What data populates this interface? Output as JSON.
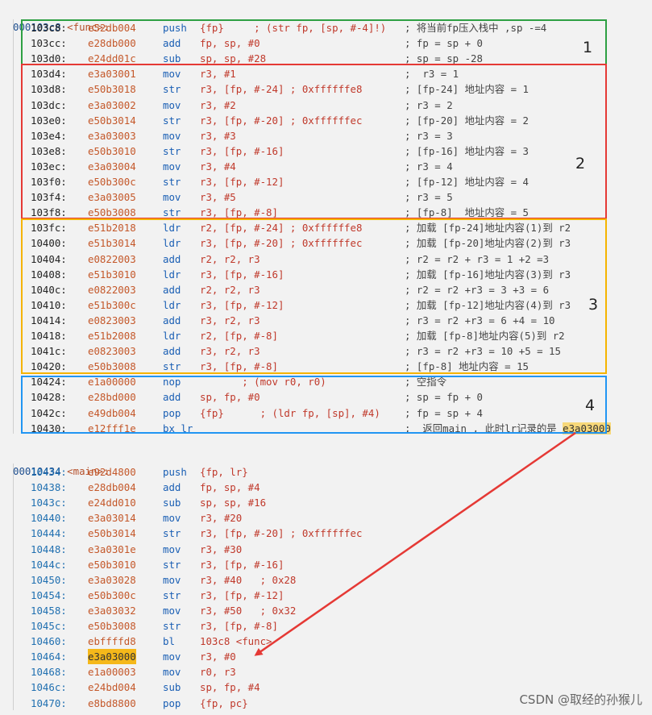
{
  "func": {
    "symbol_addr": "000103c8",
    "symbol_name": "<func>:",
    "lines": [
      {
        "addr": "103c8:",
        "code": "e52db004",
        "mn": "push",
        "ops": "{fp}     ; (str fp, [sp, #-4]!)",
        "cm": "; 将当前fp压入栈中 ,sp -=4"
      },
      {
        "addr": "103cc:",
        "code": "e28db000",
        "mn": "add",
        "ops": "fp, sp, #0",
        "cm": "; fp = sp + 0"
      },
      {
        "addr": "103d0:",
        "code": "e24dd01c",
        "mn": "sub",
        "ops": "sp, sp, #28",
        "cm": "; sp = sp -28"
      },
      {
        "addr": "103d4:",
        "code": "e3a03001",
        "mn": "mov",
        "ops": "r3, #1",
        "cm": ";  r3 = 1"
      },
      {
        "addr": "103d8:",
        "code": "e50b3018",
        "mn": "str",
        "ops": "r3, [fp, #-24] ; 0xffffffe8",
        "cm": "; [fp-24] 地址内容 = 1"
      },
      {
        "addr": "103dc:",
        "code": "e3a03002",
        "mn": "mov",
        "ops": "r3, #2",
        "cm": "; r3 = 2"
      },
      {
        "addr": "103e0:",
        "code": "e50b3014",
        "mn": "str",
        "ops": "r3, [fp, #-20] ; 0xffffffec",
        "cm": "; [fp-20] 地址内容 = 2"
      },
      {
        "addr": "103e4:",
        "code": "e3a03003",
        "mn": "mov",
        "ops": "r3, #3",
        "cm": "; r3 = 3"
      },
      {
        "addr": "103e8:",
        "code": "e50b3010",
        "mn": "str",
        "ops": "r3, [fp, #-16]",
        "cm": "; [fp-16] 地址内容 = 3"
      },
      {
        "addr": "103ec:",
        "code": "e3a03004",
        "mn": "mov",
        "ops": "r3, #4",
        "cm": "; r3 = 4"
      },
      {
        "addr": "103f0:",
        "code": "e50b300c",
        "mn": "str",
        "ops": "r3, [fp, #-12]",
        "cm": "; [fp-12] 地址内容 = 4"
      },
      {
        "addr": "103f4:",
        "code": "e3a03005",
        "mn": "mov",
        "ops": "r3, #5",
        "cm": "; r3 = 5"
      },
      {
        "addr": "103f8:",
        "code": "e50b3008",
        "mn": "str",
        "ops": "r3, [fp, #-8]",
        "cm": "; [fp-8]  地址内容 = 5"
      },
      {
        "addr": "103fc:",
        "code": "e51b2018",
        "mn": "ldr",
        "ops": "r2, [fp, #-24] ; 0xffffffe8",
        "cm": "; 加载 [fp-24]地址内容(1)到 r2"
      },
      {
        "addr": "10400:",
        "code": "e51b3014",
        "mn": "ldr",
        "ops": "r3, [fp, #-20] ; 0xffffffec",
        "cm": "; 加载 [fp-20]地址内容(2)到 r3"
      },
      {
        "addr": "10404:",
        "code": "e0822003",
        "mn": "add",
        "ops": "r2, r2, r3",
        "cm": "; r2 = r2 + r3 = 1 +2 =3"
      },
      {
        "addr": "10408:",
        "code": "e51b3010",
        "mn": "ldr",
        "ops": "r3, [fp, #-16]",
        "cm": "; 加载 [fp-16]地址内容(3)到 r3"
      },
      {
        "addr": "1040c:",
        "code": "e0822003",
        "mn": "add",
        "ops": "r2, r2, r3",
        "cm": "; r2 = r2 +r3 = 3 +3 = 6"
      },
      {
        "addr": "10410:",
        "code": "e51b300c",
        "mn": "ldr",
        "ops": "r3, [fp, #-12]",
        "cm": "; 加载 [fp-12]地址内容(4)到 r3"
      },
      {
        "addr": "10414:",
        "code": "e0823003",
        "mn": "add",
        "ops": "r3, r2, r3",
        "cm": "; r3 = r2 +r3 = 6 +4 = 10"
      },
      {
        "addr": "10418:",
        "code": "e51b2008",
        "mn": "ldr",
        "ops": "r2, [fp, #-8]",
        "cm": "; 加载 [fp-8]地址内容(5)到 r2"
      },
      {
        "addr": "1041c:",
        "code": "e0823003",
        "mn": "add",
        "ops": "r3, r2, r3",
        "cm": "; r3 = r2 +r3 = 10 +5 = 15"
      },
      {
        "addr": "10420:",
        "code": "e50b3008",
        "mn": "str",
        "ops": "r3, [fp, #-8]",
        "cm": "; [fp-8] 地址内容 = 15"
      },
      {
        "addr": "10424:",
        "code": "e1a00000",
        "mn": "nop",
        "ops": "       ; (mov r0, r0)",
        "cm": "; 空指令"
      },
      {
        "addr": "10428:",
        "code": "e28bd000",
        "mn": "add",
        "ops": "sp, fp, #0",
        "cm": "; sp = fp + 0"
      },
      {
        "addr": "1042c:",
        "code": "e49db004",
        "mn": "pop",
        "ops": "{fp}      ; (ldr fp, [sp], #4)",
        "cm": "; fp = sp + 4"
      },
      {
        "addr": "10430:",
        "code": "e12fff1e",
        "mn": "bx lr",
        "ops": "",
        "cm": ";  返回main , 此时lr记录的是 ",
        "cm_hl": "e3a03000"
      }
    ]
  },
  "main": {
    "symbol_addr": "00010434",
    "symbol_name": "<main>:",
    "lines": [
      {
        "addr": "10434:",
        "code": "e92d4800",
        "mn": "push",
        "ops": "{fp, lr}",
        "cm": ""
      },
      {
        "addr": "10438:",
        "code": "e28db004",
        "mn": "add",
        "ops": "fp, sp, #4",
        "cm": ""
      },
      {
        "addr": "1043c:",
        "code": "e24dd010",
        "mn": "sub",
        "ops": "sp, sp, #16",
        "cm": ""
      },
      {
        "addr": "10440:",
        "code": "e3a03014",
        "mn": "mov",
        "ops": "r3, #20",
        "cm": ""
      },
      {
        "addr": "10444:",
        "code": "e50b3014",
        "mn": "str",
        "ops": "r3, [fp, #-20] ; 0xffffffec",
        "cm": ""
      },
      {
        "addr": "10448:",
        "code": "e3a0301e",
        "mn": "mov",
        "ops": "r3, #30",
        "cm": ""
      },
      {
        "addr": "1044c:",
        "code": "e50b3010",
        "mn": "str",
        "ops": "r3, [fp, #-16]",
        "cm": ""
      },
      {
        "addr": "10450:",
        "code": "e3a03028",
        "mn": "mov",
        "ops": "r3, #40   ; 0x28",
        "cm": ""
      },
      {
        "addr": "10454:",
        "code": "e50b300c",
        "mn": "str",
        "ops": "r3, [fp, #-12]",
        "cm": ""
      },
      {
        "addr": "10458:",
        "code": "e3a03032",
        "mn": "mov",
        "ops": "r3, #50   ; 0x32",
        "cm": ""
      },
      {
        "addr": "1045c:",
        "code": "e50b3008",
        "mn": "str",
        "ops": "r3, [fp, #-8]",
        "cm": ""
      },
      {
        "addr": "10460:",
        "code": "ebffffd8",
        "mn": "bl",
        "ops": "103c8 <func>",
        "cm": ""
      },
      {
        "addr": "10464:",
        "code": "e3a03000",
        "mn": "mov",
        "ops": "r3, #0",
        "cm": "",
        "code_hl": true
      },
      {
        "addr": "10468:",
        "code": "e1a00003",
        "mn": "mov",
        "ops": "r0, r3",
        "cm": ""
      },
      {
        "addr": "1046c:",
        "code": "e24bd004",
        "mn": "sub",
        "ops": "sp, fp, #4",
        "cm": ""
      },
      {
        "addr": "10470:",
        "code": "e8bd8800",
        "mn": "pop",
        "ops": "{fp, pc}",
        "cm": ""
      }
    ]
  },
  "annotations": {
    "box1_label": "1",
    "box2_label": "2",
    "box3_label": "3",
    "box4_label": "4",
    "box1_color": "#2ea043",
    "box2_color": "#e53935",
    "box3_color": "#f5b400",
    "box4_color": "#2196f3",
    "arrow_color": "#e53935"
  },
  "watermark": "CSDN @取经的孙猴儿"
}
